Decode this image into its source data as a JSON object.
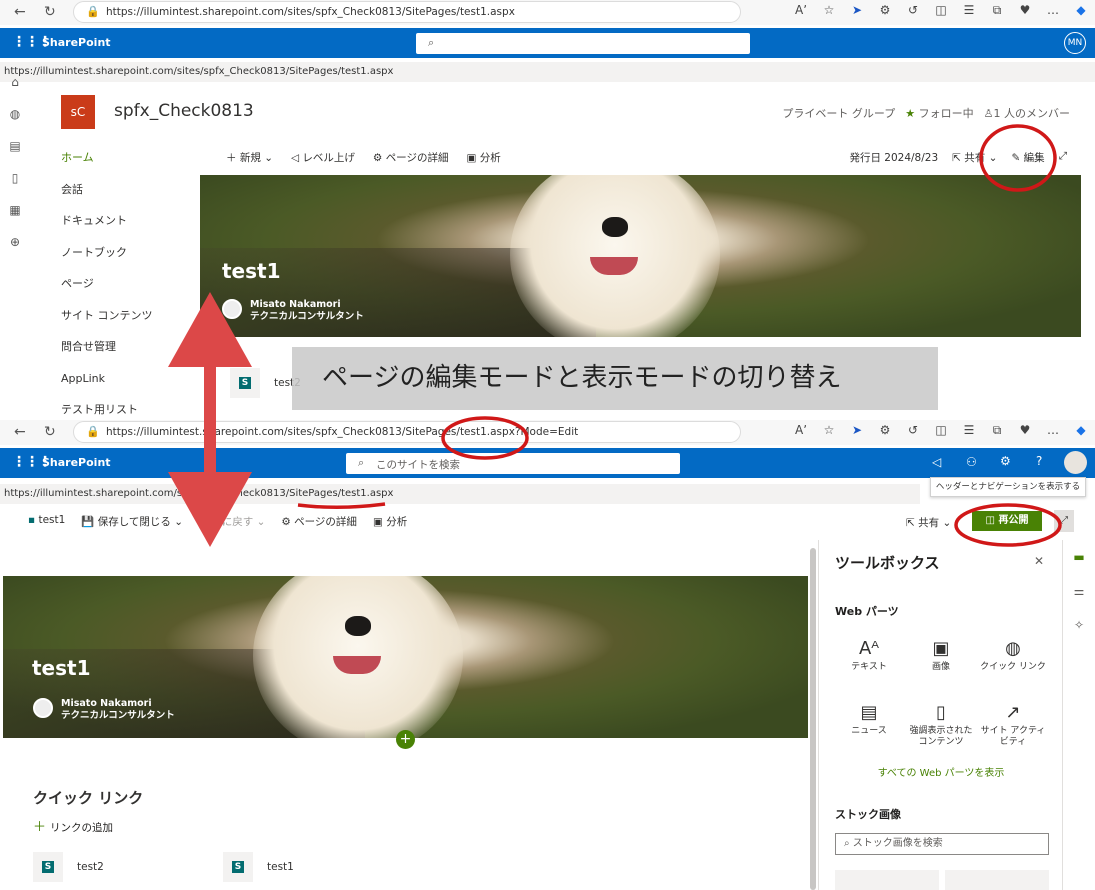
{
  "top": {
    "url": "https://illumintest.sharepoint.com/sites/spfx_Check0813/SitePages/test1.aspx",
    "suite_label": "SharePoint",
    "avatar_initials": "MN",
    "site_name": "spfx_Check0813",
    "logo_text": "sC",
    "group_type": "プライベート グループ",
    "follow": "フォロー中",
    "members": "1 人のメンバー",
    "nav": [
      "ホーム",
      "会話",
      "ドキュメント",
      "ノートブック",
      "ページ",
      "サイト コンテンツ",
      "問合せ管理",
      "AppLink",
      "テスト用リスト"
    ],
    "cmd": {
      "new": "新規",
      "promote": "レベル上げ",
      "details": "ページの詳細",
      "analytics": "分析"
    },
    "published": "発行日 2024/8/23",
    "share": "共有",
    "edit": "編集",
    "page_title": "test1",
    "author_name": "Misato Nakamori",
    "author_title": "テクニカルコンサルタント",
    "news_item": "test2"
  },
  "callout": "ページの編集モードと表示モードの切り替え",
  "bottom": {
    "url": "https://illumintest.sharepoint.com/sites/spfx_Check0813/SitePages/test1.aspx?Mode=Edit",
    "suite_label": "SharePoint",
    "search_placeholder": "このサイトを検索",
    "tip_url": "https://illumintest.sharepoint.com/sites/spfx_Check0813/SitePages/test1.aspx",
    "tooltip": "ヘッダーとナビゲーションを表示する",
    "cmd": {
      "page": "test1",
      "save_close": "保存して閉じる",
      "undo": "元に戻す",
      "details": "ページの詳細",
      "analytics": "分析"
    },
    "share": "共有",
    "republish": "再公開",
    "page_title": "test1",
    "author_name": "Misato Nakamori",
    "author_title": "テクニカルコンサルタント",
    "quick_links": "クイック リンク",
    "add_link": "リンクの追加",
    "links": [
      "test2",
      "test1"
    ]
  },
  "toolbox": {
    "title": "ツールボックス",
    "webparts_heading": "Web パーツ",
    "webparts": [
      "テキスト",
      "画像",
      "クイック リンク",
      "ニュース",
      "強調表示された コンテンツ",
      "サイト アクティビティ"
    ],
    "show_all": "すべての Web パーツを表示",
    "stock_heading": "ストック画像",
    "stock_search": "ストック画像を検索"
  },
  "colors": {
    "suite": "#036ac4",
    "accent": "#498205",
    "annotation": "#d01818"
  }
}
